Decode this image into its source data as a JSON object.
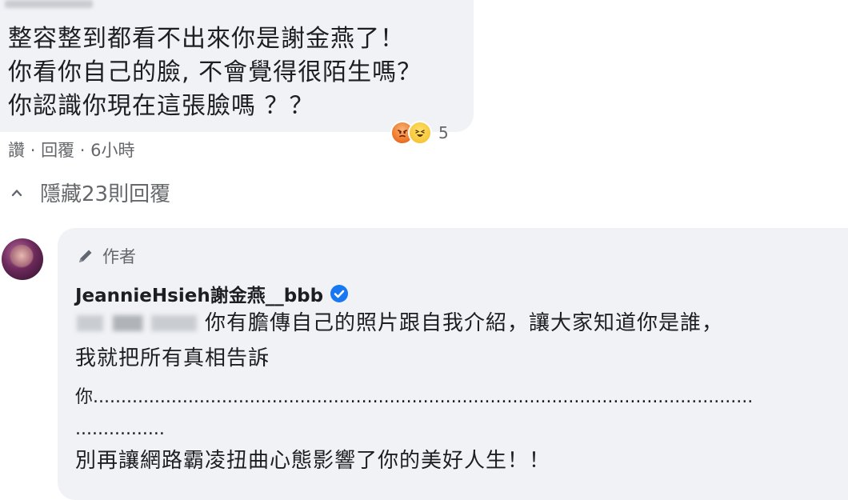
{
  "parent_comment": {
    "lines": [
      "整容整到都看不出來你是謝金燕了！",
      "你看你自己的臉, 不會覺得很陌生嗎？",
      "你認識你現在這張臉嗎 ？？"
    ],
    "reaction_count": "5",
    "reaction_icons": [
      "angry-reaction-icon",
      "haha-reaction-icon"
    ],
    "actions": {
      "like": "讚",
      "reply": "回覆",
      "time": "6小時",
      "separator": "·"
    }
  },
  "replies_toggle": {
    "label": "隱藏23則回覆",
    "icon": "chevron-up-icon"
  },
  "reply": {
    "author_badge": "作者",
    "author_name": "JeannieHsieh謝金燕__bbb",
    "verified_icon": "verified-badge-icon",
    "lines": [
      "你有膽傳自己的照片跟自我介紹，讓大家知道你是誰，",
      "我就把所有真相告訴",
      "你......................................................................................................................",
      "................",
      "別再讓網路霸凌扭曲心態影響了你的美好人生！！"
    ]
  },
  "colors": {
    "bubble": "#f0f2f5",
    "secondary_text": "#65676b",
    "primary_text": "#1c1e21",
    "verified_blue": "#1877f2"
  }
}
